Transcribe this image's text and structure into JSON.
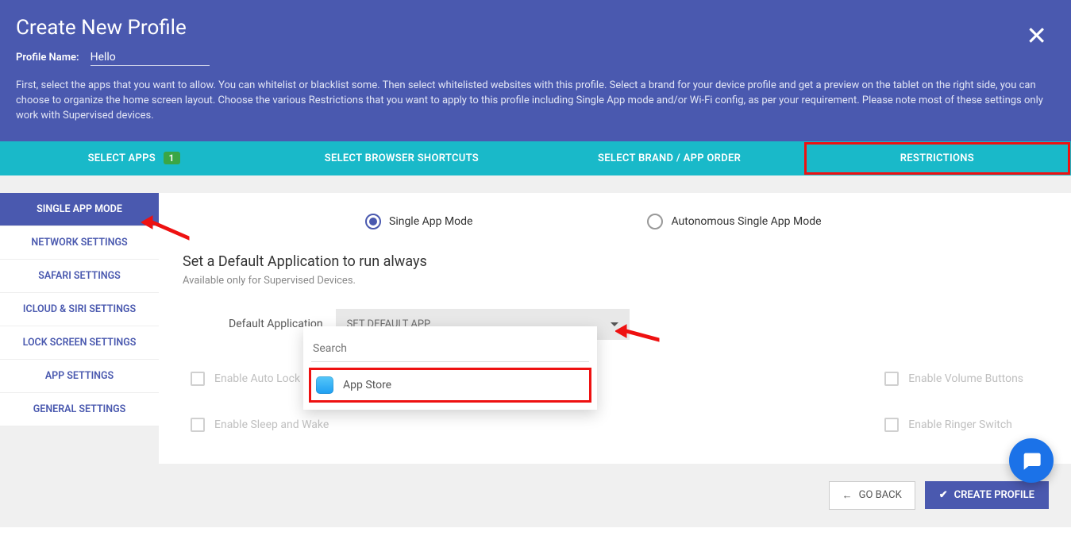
{
  "header": {
    "title": "Create New Profile",
    "profile_label": "Profile Name:",
    "profile_value": "Hello",
    "description": "First, select the apps that you want to allow. You can whitelist or blacklist some. Then select whitelisted websites with this profile. Select a brand for your device profile and get a preview on the tablet on the right side, you can choose to organize the home screen layout. Choose the various Restrictions that you want to apply to this profile including Single App mode and/or Wi-Fi config, as per your requirement. Please note most of these settings only work with Supervised devices."
  },
  "tabs": {
    "items": [
      {
        "label": "SELECT APPS",
        "badge": "1"
      },
      {
        "label": "SELECT BROWSER SHORTCUTS"
      },
      {
        "label": "SELECT BRAND / APP ORDER"
      },
      {
        "label": "RESTRICTIONS"
      }
    ]
  },
  "sidebar": {
    "items": [
      {
        "label": "SINGLE APP MODE",
        "active": true
      },
      {
        "label": "NETWORK SETTINGS"
      },
      {
        "label": "SAFARI SETTINGS"
      },
      {
        "label": "ICLOUD & SIRI SETTINGS"
      },
      {
        "label": "LOCK SCREEN SETTINGS"
      },
      {
        "label": "APP SETTINGS"
      },
      {
        "label": "GENERAL SETTINGS"
      }
    ]
  },
  "modes": {
    "single": "Single App Mode",
    "autonomous": "Autonomous Single App Mode"
  },
  "section": {
    "title": "Set a Default Application to run always",
    "sub": "Available only for Supervised Devices."
  },
  "default_app": {
    "label": "Default Application",
    "placeholder": "SET DEFAULT APP",
    "search_placeholder": "Search",
    "options": [
      {
        "label": "App Store"
      }
    ]
  },
  "checkboxes": {
    "col1": [
      "Enable Auto Lock",
      "Enable Sleep and Wake"
    ],
    "col2": [
      "Enable Volume Buttons",
      "Enable Ringer Switch"
    ]
  },
  "footer": {
    "back": "GO BACK",
    "create": "CREATE PROFILE"
  }
}
